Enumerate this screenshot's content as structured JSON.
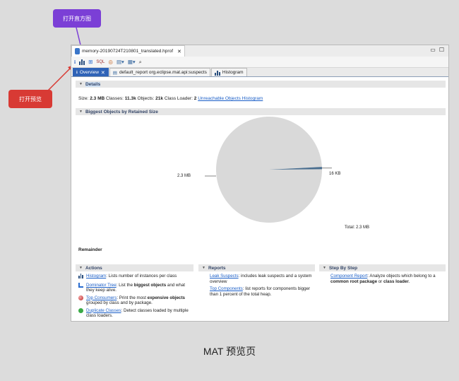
{
  "annotations": {
    "open_histogram": "打开直方图",
    "open_overview": "打开预览"
  },
  "editor": {
    "file_tab": "memory-20190724T210801_translated.hprof",
    "close_glyph": "✕"
  },
  "toolbar": {
    "icons": [
      "info-icon",
      "histogram-icon",
      "dominator-tree-icon",
      "oql-icon",
      "thread-overview-icon",
      "report-dropdown-icon",
      "query-browser-icon",
      "search-icon"
    ]
  },
  "pane_tabs": [
    {
      "label": "Overview",
      "icon": "info-icon"
    },
    {
      "label": "default_report  org.eclipse.mat.api:suspects",
      "icon": "report-icon"
    },
    {
      "label": "Histogram",
      "icon": "histogram-icon"
    }
  ],
  "details": {
    "header": "Details",
    "size_label": "Size:",
    "size_value": "2.3 MB",
    "classes_label": "Classes:",
    "classes_value": "11.3k",
    "objects_label": "Objects:",
    "objects_value": "21k",
    "loader_label": "Class Loader:",
    "loader_value": "2",
    "unreachable_link": "Unreachable Objects Histogram"
  },
  "biggest_objects": {
    "header": "Biggest Objects by Retained Size",
    "remainder_label": "Remainder"
  },
  "chart_data": {
    "type": "pie",
    "slices": [
      {
        "label": "2.3 MB",
        "value_kb": 2339,
        "color": "#d9d9d9"
      },
      {
        "label": "16 KB",
        "value_kb": 16,
        "color": "#4a6e8f"
      }
    ],
    "total_label": "Total: 2.3 MB"
  },
  "actions": {
    "header": "Actions",
    "items": [
      {
        "link": "Histogram",
        "text": ": Lists number of instances per class",
        "icon": "histogram-icon"
      },
      {
        "link": "Dominator Tree",
        "text": ": List the ",
        "bold": "biggest objects",
        "text2": " and what they keep alive.",
        "icon": "dominator-tree-icon"
      },
      {
        "link": "Top Consumers",
        "text": ": Print the most ",
        "bold": "expensive objects",
        "text2": " grouped by class and by package.",
        "icon": "top-consumers-icon"
      },
      {
        "link": "Duplicate Classes",
        "text": ": Detect classes loaded by multiple class loaders.",
        "icon": "duplicate-classes-icon"
      }
    ]
  },
  "reports": {
    "header": "Reports",
    "items": [
      {
        "link": "Leak Suspects",
        "text": ": includes leak suspects and a system overview"
      },
      {
        "link": "Top Components",
        "text": ": list reports for components bigger than 1 percent of the total heap."
      }
    ]
  },
  "steps": {
    "header": "Step By Step",
    "items": [
      {
        "link": "Component Report",
        "text": ": Analyze objects which belong to a ",
        "bold": "common root package",
        "text2": " or ",
        "bold2": "class loader",
        "text3": "."
      }
    ]
  },
  "caption": "MAT 预览页"
}
